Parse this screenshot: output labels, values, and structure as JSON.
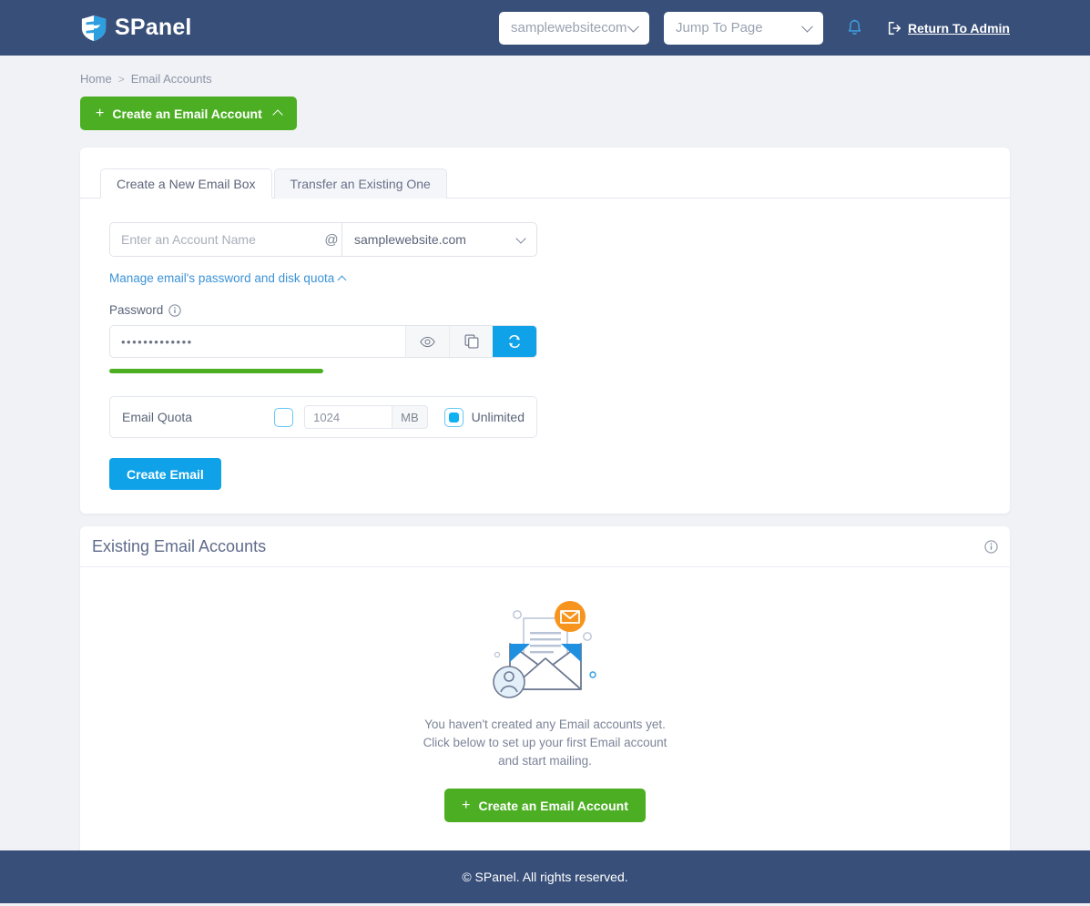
{
  "header": {
    "brand": "SPanel",
    "site_select": {
      "value": "samplewebsitecom"
    },
    "jump_select": {
      "value": "Jump To Page"
    },
    "bell_icon": "bell-icon",
    "admin_link": "Return To Admin"
  },
  "breadcrumb": {
    "home": "Home",
    "separator": ">",
    "current": "Email Accounts"
  },
  "actions": {
    "create_account": "Create an Email Account",
    "plus": "+"
  },
  "tabs": [
    {
      "label": "Create a New Email Box",
      "active": true
    },
    {
      "label": "Transfer an Existing One",
      "active": false
    }
  ],
  "form": {
    "account_placeholder": "Enter an Account Name",
    "account_value": "",
    "at": "@",
    "domain": "samplewebsite.com",
    "manage_link": "Manage email's password and disk quota",
    "password_label": "Password",
    "password_value": "•••••••••••••",
    "password_strength_pct": "50",
    "strength_color": "#4caf23",
    "eye_icon": "eye-icon",
    "copy_icon": "copy-icon",
    "generate_icon": "refresh-icon",
    "quota_label": "Email Quota",
    "quota_value": "1024",
    "quota_unit": "MB",
    "quota_unlimited_label": "Unlimited",
    "quota_unlimited_selected": true,
    "submit_label": "Create Email"
  },
  "existing": {
    "title": "Existing Email Accounts",
    "info_icon": "info-icon",
    "empty_text": "You haven't created any Email accounts yet. Click below to set up your first Email account and start mailing.",
    "empty_button": "Create an Email Account"
  },
  "footer": {
    "copyright": "© SPanel. All rights reserved."
  },
  "colors": {
    "navy": "#384f79",
    "green": "#4caf23",
    "blue": "#0fa2e8",
    "page_bg": "#f1f2f6",
    "orange": "#f7941e"
  }
}
